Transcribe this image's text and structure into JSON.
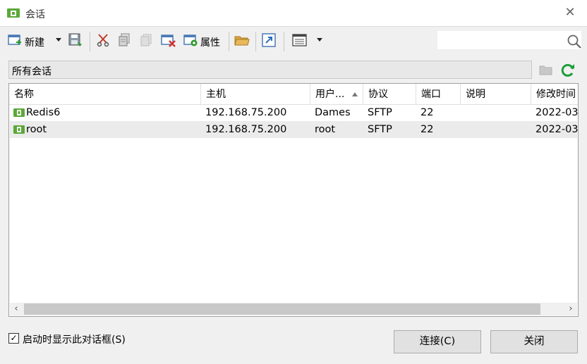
{
  "window": {
    "title": "会话"
  },
  "toolbar": {
    "new_label": "新建",
    "properties_label": "属性",
    "search_placeholder": ""
  },
  "group": {
    "label": "所有会话"
  },
  "columns": [
    "名称",
    "主机",
    "用户...",
    "协议",
    "端口",
    "说明",
    "修改时间"
  ],
  "sessions": [
    {
      "name": "Redis6",
      "host": "192.168.75.200",
      "user": "Dames",
      "protocol": "SFTP",
      "port": "22",
      "description": "",
      "modified": "2022-03"
    },
    {
      "name": "root",
      "host": "192.168.75.200",
      "user": "root",
      "protocol": "SFTP",
      "port": "22",
      "description": "",
      "modified": "2022-03"
    }
  ],
  "footer": {
    "startup_checkbox_label": "启动时显示此对话框(S)",
    "startup_checked": true,
    "connect_label": "连接(C)",
    "close_label": "关闭"
  },
  "colors": {
    "accent_green": "#5ba83a",
    "refresh_green": "#1b9e3a"
  }
}
